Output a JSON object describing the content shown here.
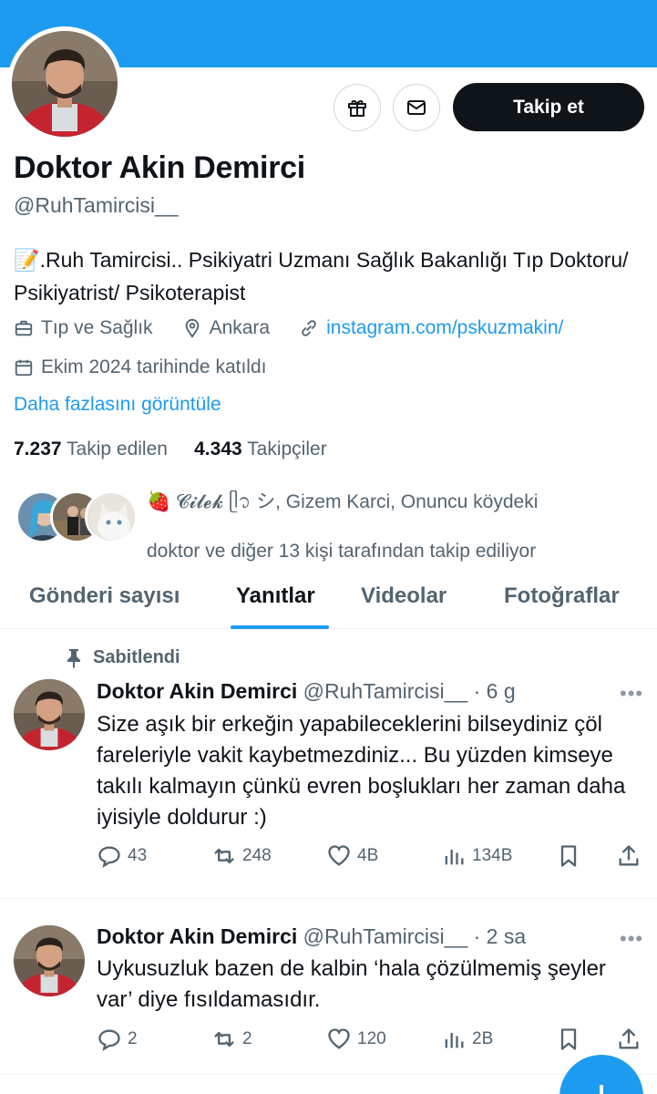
{
  "colors": {
    "accent": "#1d9bf0",
    "text": "#0f1419",
    "muted": "#536471",
    "button_dark": "#0f1419"
  },
  "profile": {
    "name": "Doktor Akin Demirci",
    "handle": "@RuhTamircisi__",
    "bio_emoji": "📝",
    "bio": ".Ruh Tamircisi.. Psikiyatri Uzmanı Sağlık Bakanlığı Tıp Doktoru/ Psikiyatrist/ Psikoterapist",
    "category": "Tıp ve Sağlık",
    "location": "Ankara",
    "website": "instagram.com/pskuzmakin/",
    "joined": "Ekim 2024 tarihinde katıldı",
    "show_more": "Daha fazlasını görüntüle",
    "following_count": "7.237",
    "following_label": "Takip edilen",
    "followers_count": "4.343",
    "followers_label": "Takipçiler",
    "followed_by_line1": "🍓 𝓒𝓲𝓵𝓮𝓴 ᥫ᭡ シ, Gizem Karci, Onuncu köydeki",
    "followed_by_line2": "doktor ve diğer 13 kişi tarafından takip ediliyor",
    "follow_button": "Takip et"
  },
  "icons": {
    "gift": "gift-icon",
    "mail": "mail-icon",
    "briefcase": "briefcase-icon",
    "location": "location-pin-icon",
    "link": "link-icon",
    "calendar": "calendar-icon",
    "pin": "pin-icon",
    "reply": "reply-icon",
    "retweet": "retweet-icon",
    "like": "heart-icon",
    "views": "views-icon",
    "bookmark": "bookmark-icon",
    "share": "share-icon",
    "compose": "compose-plus-icon"
  },
  "tabs": [
    {
      "label": "Gönderi sayısı",
      "active": false
    },
    {
      "label": "Yanıtlar",
      "active": true
    },
    {
      "label": "Videolar",
      "active": false
    },
    {
      "label": "Fotoğraflar",
      "active": false
    }
  ],
  "tweets": [
    {
      "pinned_label": "Sabitlendi",
      "name": "Doktor Akin Demirci",
      "handle": "@RuhTamircisi__",
      "time": "· 6 g",
      "text": "Size aşık bir erkeğin yapabileceklerini bilseydiniz çöl fareleriyle vakit kaybetmezdiniz...  Bu yüzden kimseye takılı kalmayın çünkü evren boşlukları her zaman daha iyisiyle doldurur :)",
      "replies": "43",
      "retweets": "248",
      "likes": "4B",
      "views": "134B"
    },
    {
      "name": "Doktor Akin Demirci",
      "handle": "@RuhTamircisi__",
      "time": "· 2 sa",
      "text": "Uykusuzluk bazen de kalbin ‘hala çözülmemiş şeyler var’ diye fısıldamasıdır.",
      "replies": "2",
      "retweets": "2",
      "likes": "120",
      "views": "2B"
    }
  ],
  "more_dots": "•••",
  "compose_plus": "+"
}
